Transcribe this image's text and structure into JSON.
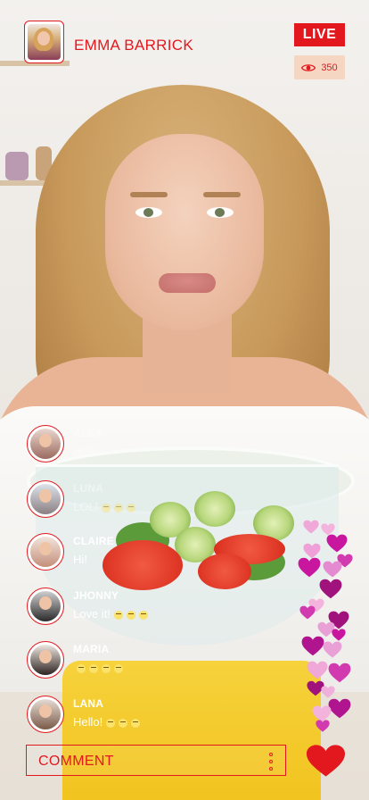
{
  "header": {
    "streamer_name": "EMMA BARRICK",
    "live_label": "LIVE",
    "viewer_count": "350"
  },
  "comments": [
    {
      "name": "ALEX",
      "text": "Hello!",
      "emojis": 0
    },
    {
      "name": "LUNA",
      "text": "LOL!",
      "emojis": 3
    },
    {
      "name": "CLAIRE",
      "text": "Hi!",
      "emojis": 0
    },
    {
      "name": "JHONNY",
      "text": "Love it!",
      "emojis": 3
    },
    {
      "name": "MARIA",
      "text": "",
      "emojis": 4
    },
    {
      "name": "LANA",
      "text": "Hello!",
      "emojis": 3
    }
  ],
  "composer": {
    "placeholder": "COMMENT"
  },
  "colors": {
    "accent": "#e3181f",
    "viewer_badge_bg": "#f4d6c3",
    "heart_pink": "#f0a0d8",
    "heart_magenta": "#c8179e"
  },
  "icons": {
    "viewers": "eye-icon",
    "more": "more-vertical-icon",
    "like": "heart-icon"
  }
}
